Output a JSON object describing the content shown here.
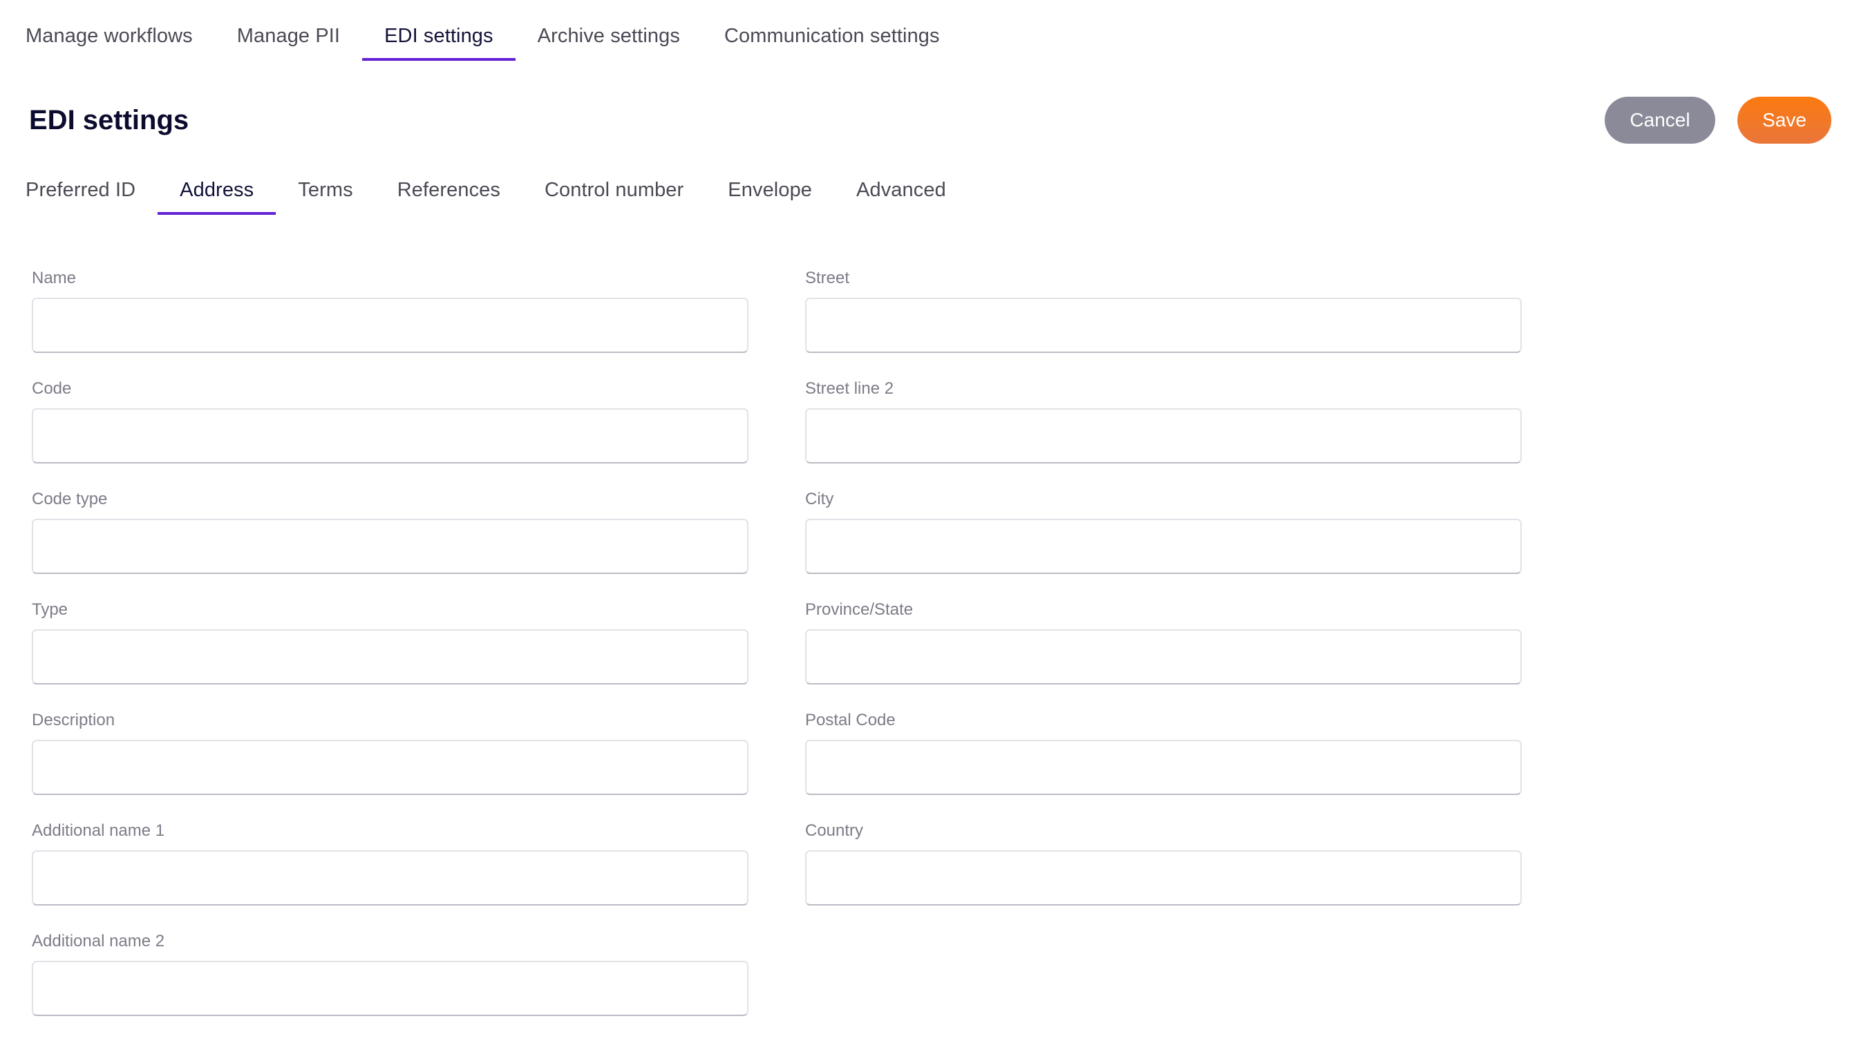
{
  "top_tabs": [
    {
      "label": "Manage workflows",
      "active": false
    },
    {
      "label": "Manage PII",
      "active": false
    },
    {
      "label": "EDI settings",
      "active": true
    },
    {
      "label": "Archive settings",
      "active": false
    },
    {
      "label": "Communication settings",
      "active": false
    }
  ],
  "header": {
    "title": "EDI settings",
    "cancel_label": "Cancel",
    "save_label": "Save"
  },
  "sub_tabs": [
    {
      "label": "Preferred ID",
      "active": false
    },
    {
      "label": "Address",
      "active": true
    },
    {
      "label": "Terms",
      "active": false
    },
    {
      "label": "References",
      "active": false
    },
    {
      "label": "Control number",
      "active": false
    },
    {
      "label": "Envelope",
      "active": false
    },
    {
      "label": "Advanced",
      "active": false
    }
  ],
  "form": {
    "left_fields": [
      {
        "label": "Name",
        "value": ""
      },
      {
        "label": "Code",
        "value": ""
      },
      {
        "label": "Code type",
        "value": ""
      },
      {
        "label": "Type",
        "value": ""
      },
      {
        "label": "Description",
        "value": ""
      },
      {
        "label": "Additional name 1",
        "value": ""
      },
      {
        "label": "Additional name 2",
        "value": ""
      }
    ],
    "right_fields": [
      {
        "label": "Street",
        "value": ""
      },
      {
        "label": "Street line 2",
        "value": ""
      },
      {
        "label": "City",
        "value": ""
      },
      {
        "label": "Province/State",
        "value": ""
      },
      {
        "label": "Postal Code",
        "value": ""
      },
      {
        "label": "Country",
        "value": ""
      }
    ]
  },
  "colors": {
    "accent": "#6322d4",
    "cancel_button": "#8a8a99",
    "save_button": "#fb7a10",
    "title_text": "#0b0b2e"
  }
}
